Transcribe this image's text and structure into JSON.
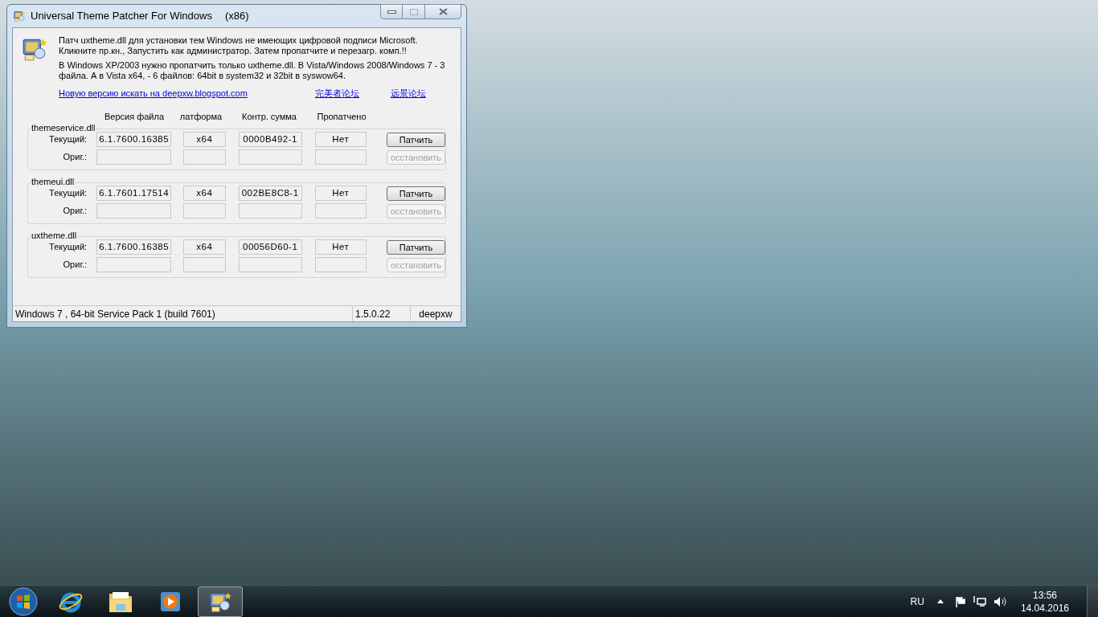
{
  "window": {
    "title": "Universal Theme Patcher For Windows",
    "arch": "(x86)",
    "paragraphs": [
      [
        "Патч uxtheme.dll для установки тем Windows не имеющих цифровой подписи Microsoft.",
        "Кликните пр.кн., Запустить как администратор. Затем пропатчите и перезагр. комп.!!"
      ],
      [
        "В Windows XP/2003 нужно пропатчить только uxtheme.dll. В Vista/Windows 2008/Windows 7 - 3",
        "файла. А в Vista x64, - 6 файлов: 64bit в system32 и 32bit в syswow64."
      ]
    ],
    "links": [
      "Новую версию искать на deepxw.blogspot.com",
      "完美者论坛",
      "远景论坛"
    ],
    "columns": [
      "Версия файла",
      "латформа",
      "Контр. сумма",
      "Пропатчено"
    ],
    "groups": [
      {
        "name": "themeservice.dll",
        "labels": [
          "Текущий:",
          "Ориг.:"
        ],
        "current": [
          "6.1.7600.16385",
          "x64",
          "0000B492-1",
          "Нет"
        ],
        "buttons": [
          {
            "label": "Патчить",
            "disabled": false
          },
          {
            "label": "осстановить",
            "disabled": true
          }
        ]
      },
      {
        "name": "themeui.dll",
        "labels": [
          "Текущий:",
          "Ориг.:"
        ],
        "current": [
          "6.1.7601.17514",
          "x64",
          "002BE8C8-1",
          "Нет"
        ],
        "buttons": [
          {
            "label": "Патчить",
            "disabled": false
          },
          {
            "label": "осстановить",
            "disabled": true
          }
        ]
      },
      {
        "name": "uxtheme.dll",
        "labels": [
          "Текущий:",
          "Ориг.:"
        ],
        "current": [
          "6.1.7600.16385",
          "x64",
          "00056D60-1",
          "Нет"
        ],
        "buttons": [
          {
            "label": "Патчить",
            "disabled": false
          },
          {
            "label": "осстановить",
            "disabled": true
          }
        ]
      }
    ],
    "status_bar": [
      "Windows 7 , 64-bit Service Pack 1 (build 7601)",
      "1.5.0.22",
      "deepxw"
    ]
  },
  "taskbar": {
    "items": [
      {
        "kind": "start",
        "selected": false
      },
      {
        "kind": "browser",
        "selected": false
      },
      {
        "kind": "folder",
        "selected": false
      },
      {
        "kind": "media",
        "selected": false
      },
      {
        "kind": "patcher",
        "selected": true
      }
    ],
    "language": "RU",
    "time": "13:56",
    "date": "14.04.2016"
  }
}
